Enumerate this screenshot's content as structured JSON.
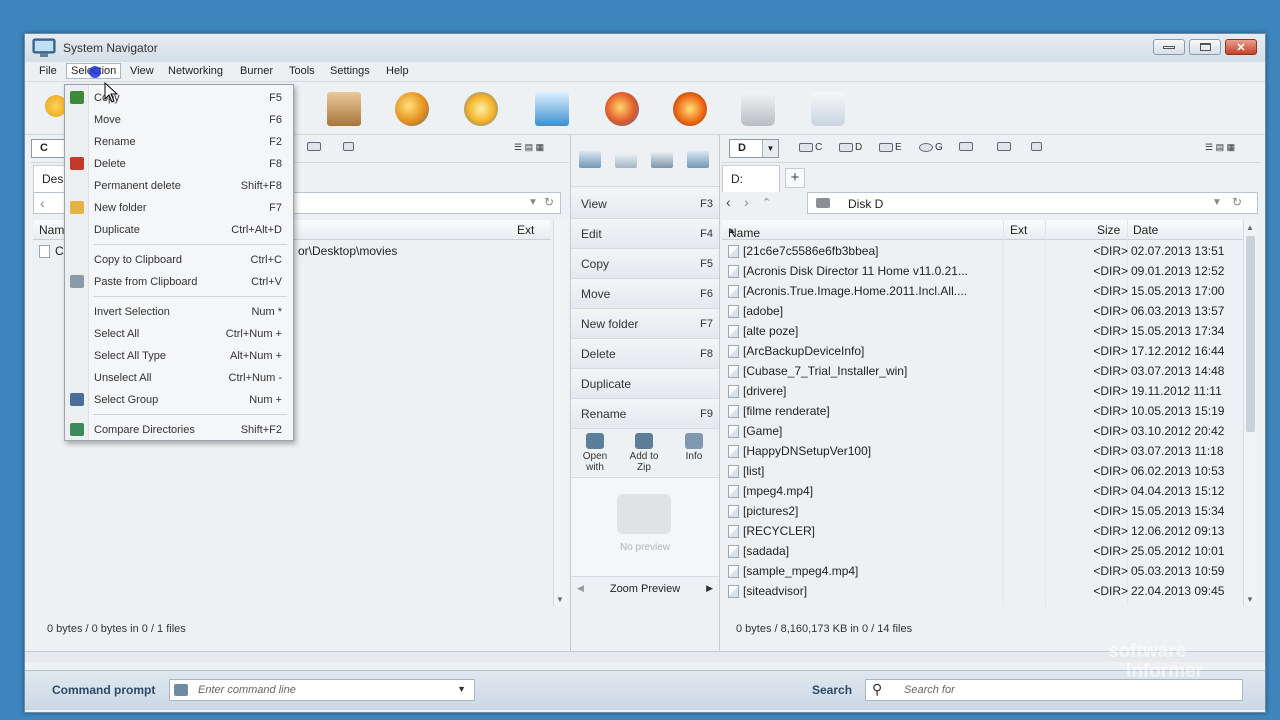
{
  "window": {
    "title": "System Navigator"
  },
  "menubar": [
    {
      "label": "File"
    },
    {
      "label": "Selection"
    },
    {
      "label": "View"
    },
    {
      "label": "Networking"
    },
    {
      "label": "Burner"
    },
    {
      "label": "Tools"
    },
    {
      "label": "Settings"
    },
    {
      "label": "Help"
    }
  ],
  "selection_menu": [
    {
      "label": "Copy",
      "key": "F5",
      "icon": "copy-icon"
    },
    {
      "label": "Move",
      "key": "F6"
    },
    {
      "label": "Rename",
      "key": "F2"
    },
    {
      "label": "Delete",
      "key": "F8",
      "icon": "delete-icon"
    },
    {
      "label": "Permanent delete",
      "key": "Shift+F8"
    },
    {
      "label": "New folder",
      "key": "F7",
      "icon": "new-folder-icon"
    },
    {
      "label": "Duplicate",
      "key": "Ctrl+Alt+D"
    },
    {
      "label": "Copy to Clipboard",
      "key": "Ctrl+C"
    },
    {
      "label": "Paste from Clipboard",
      "key": "Ctrl+V",
      "icon": "clipboard-icon"
    },
    {
      "label": "Invert Selection",
      "key": "Num *"
    },
    {
      "label": "Select All",
      "key": "Ctrl+Num +"
    },
    {
      "label": "Select All Type",
      "key": "Alt+Num +"
    },
    {
      "label": "Unselect All",
      "key": "Ctrl+Num -"
    },
    {
      "label": "Select Group",
      "key": "Num +",
      "icon": "select-group-icon"
    },
    {
      "label": "Compare Directories",
      "key": "Shift+F2",
      "icon": "compare-icon"
    }
  ],
  "left_panel": {
    "drive": "C",
    "tab": "Desk",
    "path_tail": "or\\Desktop\\movies",
    "col_name": "Nam",
    "col_ext": "Ext",
    "first_row_prefix": "C",
    "status": "0 bytes / 0 bytes  in  0 / 1 files"
  },
  "middle_panel": {
    "commands": [
      {
        "label": "View",
        "key": "F3"
      },
      {
        "label": "Edit",
        "key": "F4"
      },
      {
        "label": "Copy",
        "key": "F5"
      },
      {
        "label": "Move",
        "key": "F6"
      },
      {
        "label": "New folder",
        "key": "F7"
      },
      {
        "label": "Delete",
        "key": "F8"
      },
      {
        "label": "Duplicate",
        "key": ""
      },
      {
        "label": "Rename",
        "key": "F9"
      }
    ],
    "open_with": "Open with",
    "add_to_zip": "Add to Zip",
    "info": "Info",
    "no_preview": "No preview",
    "zoom_preview": "Zoom Preview"
  },
  "right_panel": {
    "drive": "D",
    "drives": [
      {
        "label": "C"
      },
      {
        "label": "D"
      },
      {
        "label": "E"
      },
      {
        "label": "G"
      }
    ],
    "tab": "D:",
    "path": "Disk D",
    "columns": {
      "name": "Name",
      "ext": "Ext",
      "size": "Size",
      "date": "Date"
    },
    "rows": [
      {
        "name": "[21c6e7c5586e6fb3bbea]",
        "size": "<DIR>",
        "date": "02.07.2013 13:51"
      },
      {
        "name": "[Acronis Disk Director 11 Home v11.0.21...",
        "size": "<DIR>",
        "date": "09.01.2013 12:52"
      },
      {
        "name": "[Acronis.True.Image.Home.2011.Incl.All....",
        "size": "<DIR>",
        "date": "15.05.2013 17:00"
      },
      {
        "name": "[adobe]",
        "size": "<DIR>",
        "date": "06.03.2013 13:57"
      },
      {
        "name": "[alte poze]",
        "size": "<DIR>",
        "date": "15.05.2013 17:34"
      },
      {
        "name": "[ArcBackupDeviceInfo]",
        "size": "<DIR>",
        "date": "17.12.2012 16:44"
      },
      {
        "name": "[Cubase_7_Trial_Installer_win]",
        "size": "<DIR>",
        "date": "03.07.2013 14:48"
      },
      {
        "name": "[drivere]",
        "size": "<DIR>",
        "date": "19.11.2012 11:11"
      },
      {
        "name": "[filme renderate]",
        "size": "<DIR>",
        "date": "10.05.2013 15:19"
      },
      {
        "name": "[Game]",
        "size": "<DIR>",
        "date": "03.10.2012 20:42"
      },
      {
        "name": "[HappyDNSetupVer100]",
        "size": "<DIR>",
        "date": "03.07.2013 11:18"
      },
      {
        "name": "[list]",
        "size": "<DIR>",
        "date": "06.02.2013 10:53"
      },
      {
        "name": "[mpeg4.mp4]",
        "size": "<DIR>",
        "date": "04.04.2013 15:12"
      },
      {
        "name": "[pictures2]",
        "size": "<DIR>",
        "date": "15.05.2013 15:34"
      },
      {
        "name": "[RECYCLER]",
        "size": "<DIR>",
        "date": "12.06.2012 09:13"
      },
      {
        "name": "[sadada]",
        "size": "<DIR>",
        "date": "25.05.2012 10:01"
      },
      {
        "name": "[sample_mpeg4.mp4]",
        "size": "<DIR>",
        "date": "05.03.2013 10:59"
      },
      {
        "name": "[siteadvisor]",
        "size": "<DIR>",
        "date": "22.04.2013 09:45"
      }
    ],
    "status": "0 bytes / 8,160,173 KB  in  0 / 14 files"
  },
  "bottom": {
    "command_label": "Command prompt",
    "command_placeholder": "Enter command line",
    "search_label": "Search",
    "search_placeholder": "Search for"
  },
  "watermark": {
    "line1": "software",
    "line2": "informer"
  },
  "colors": {
    "accent": "#3d85bc",
    "close": "#c6412a"
  }
}
